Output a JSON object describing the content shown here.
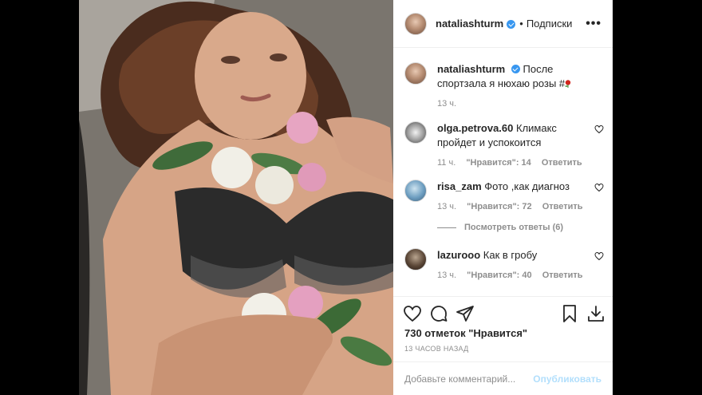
{
  "post": {
    "username": "nataliashturm",
    "separator": "•",
    "follow_label": "Подписки",
    "more_label": "•••",
    "caption": {
      "username": "nataliashturm",
      "text": "После спортзала я нюхаю розы #",
      "time": "13 ч."
    },
    "comments": [
      {
        "username": "olga.petrova.60",
        "text": "Климакс пройдет и успокоится",
        "time": "11 ч.",
        "likes": "\"Нравится\": 14",
        "reply": "Ответить"
      },
      {
        "username": "risa_zam",
        "text": "Фото ,как диагноз",
        "time": "13 ч.",
        "likes": "\"Нравится\": 72",
        "reply": "Ответить"
      },
      {
        "username": "lazurooo",
        "text": "Как в гробу",
        "time": "13 ч.",
        "likes": "\"Нравится\": 40",
        "reply": "Ответить"
      }
    ],
    "view_replies": "Посмотреть ответы (6)",
    "like_count": "730 отметок \"Нравится\"",
    "posted_ago": "13 ЧАСОВ НАЗАД",
    "comment_placeholder": "Добавьте комментарий...",
    "publish_label": "Опубликовать"
  },
  "icons": {
    "like": "heart-icon",
    "comment": "comment-icon",
    "share": "paper-plane-icon",
    "save": "bookmark-icon",
    "download": "download-icon",
    "verified": "verified-badge-icon"
  },
  "colors": {
    "verified": "#3897f0",
    "publish_disabled": "#b2dffc",
    "meta_gray": "#8e8e8e"
  }
}
